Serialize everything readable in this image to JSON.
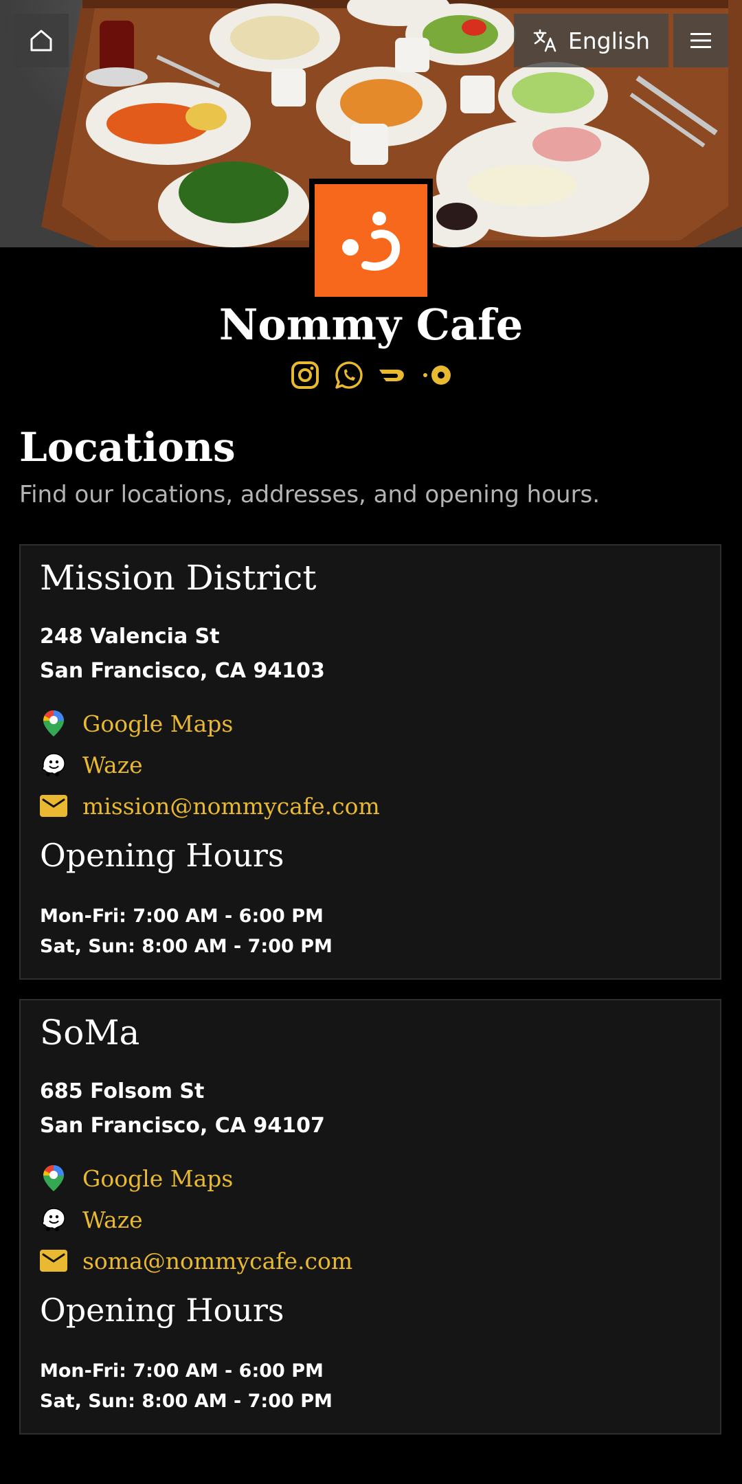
{
  "header": {
    "language_label": "English",
    "icons": [
      "home-icon",
      "translate-icon",
      "menu-icon"
    ]
  },
  "brand": {
    "name": "Nommy Cafe",
    "logo_color": "#f7671c",
    "accent_color": "#e8b931",
    "social_icons": [
      "instagram-icon",
      "whatsapp-icon",
      "doordash-icon",
      "postmates-icon"
    ]
  },
  "page": {
    "title": "Locations",
    "subtitle": "Find our locations, addresses, and opening hours."
  },
  "locations": [
    {
      "name": "Mission District",
      "address_line1": "248 Valencia St",
      "address_line2": "San Francisco, CA 94103",
      "maps_label": "Google Maps",
      "waze_label": "Waze",
      "email": "mission@nommycafe.com",
      "hours_title": "Opening Hours",
      "hours": [
        "Mon-Fri: 7:00 AM - 6:00 PM",
        "Sat, Sun: 8:00 AM - 7:00 PM"
      ]
    },
    {
      "name": "SoMa",
      "address_line1": "685 Folsom St",
      "address_line2": "San Francisco, CA 94107",
      "maps_label": "Google Maps",
      "waze_label": "Waze",
      "email": "soma@nommycafe.com",
      "hours_title": "Opening Hours",
      "hours": [
        "Mon-Fri: 7:00 AM - 6:00 PM",
        "Sat, Sun: 8:00 AM - 7:00 PM"
      ]
    }
  ]
}
